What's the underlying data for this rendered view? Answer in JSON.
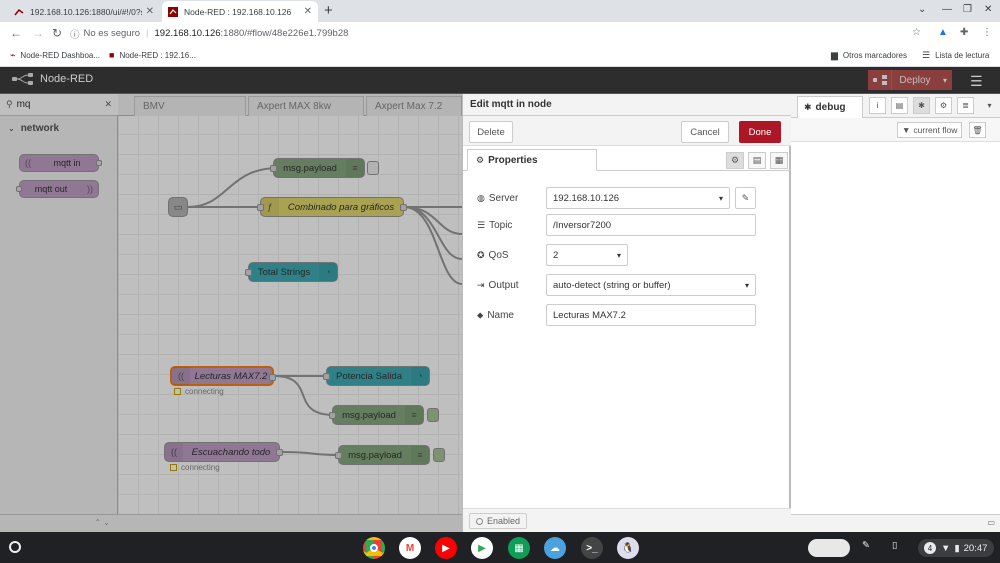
{
  "browser": {
    "tabs": [
      {
        "title": "192.168.10.126:1880/ui/#!/0?soc",
        "active": false
      },
      {
        "title": "Node-RED : 192.168.10.126",
        "active": true
      }
    ],
    "new_tab": "+",
    "address": {
      "security": "No es seguro",
      "host": "192.168.10.126",
      "path": ":1880/#flow/48e226e1.799b28"
    },
    "bookmarks": [
      {
        "label": "Node-RED Dashboa..."
      },
      {
        "label": "Node-RED : 192.16..."
      }
    ],
    "other_bookmarks": "Otros marcadores",
    "reading_list": "Lista de lectura"
  },
  "nodered": {
    "app_name": "Node-RED",
    "deploy_label": "Deploy",
    "palette": {
      "search_value": "mq",
      "category": "network",
      "nodes": [
        "mqtt in",
        "mqtt out"
      ]
    },
    "workspace_tabs": [
      "BMV",
      "Axpert MAX 8kw",
      "Axpert Max 7.2"
    ],
    "flow_nodes": {
      "debug1": "msg.payload",
      "combinado": "Combinado para gráficos",
      "total_strings": "Total Strings",
      "lecturas": "Lecturas MAX7.2",
      "lecturas_status": "connecting",
      "potencia": "Potencia Salida",
      "debug2": "msg.payload",
      "escuchando": "Escuachando todo",
      "escuchando_status": "connecting",
      "debug3": "msg.payload"
    },
    "edit_tray": {
      "title": "Edit mqtt in node",
      "delete": "Delete",
      "cancel": "Cancel",
      "done": "Done",
      "tab": "Properties",
      "fields": {
        "server_label": "Server",
        "server_value": "192.168.10.126",
        "topic_label": "Topic",
        "topic_value": "/Inversor7200",
        "qos_label": "QoS",
        "qos_value": "2",
        "output_label": "Output",
        "output_value": "auto-detect (string or buffer)",
        "name_label": "Name",
        "name_value": "Lecturas MAX7.2"
      },
      "enabled": "Enabled"
    },
    "sidebar": {
      "tab": "debug",
      "filter": "current flow"
    }
  },
  "taskbar": {
    "notification_count": "4",
    "time": "20:47"
  },
  "colors": {
    "header": "#2d2d2d",
    "deploy": "#aa4444",
    "done": "#ad1625",
    "mqtt_node": "#c0a0c7",
    "debug_node": "#87a980",
    "function_node": "#e2d96e",
    "dashboard_node": "#3fadb5"
  }
}
